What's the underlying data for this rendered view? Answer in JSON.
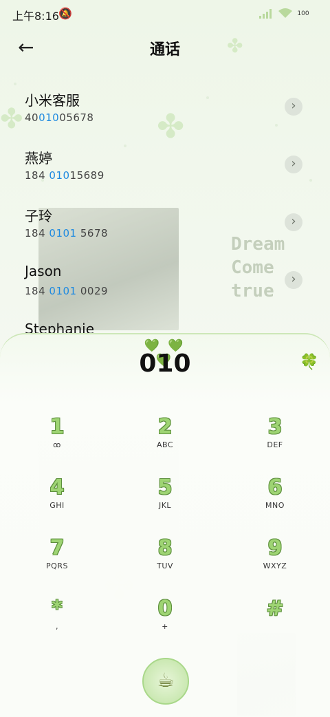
{
  "status_bar": {
    "time": "上午8:16",
    "mute_icon": "bell-off-icon",
    "battery": "100"
  },
  "header": {
    "back_icon": "arrow-left-icon",
    "title": "通话"
  },
  "results": [
    {
      "name": "小米客服",
      "number_pre": "40",
      "number_hl": "010",
      "number_post": "05678"
    },
    {
      "name": "燕婷",
      "number_pre": "184 ",
      "number_hl": "010",
      "number_post": "15689"
    },
    {
      "name": "子玲",
      "number_pre": "184 ",
      "number_hl": "0101",
      "number_post": " 5678"
    },
    {
      "name": "Jason",
      "number_pre": "184 ",
      "number_hl": "0101",
      "number_post": " 0029"
    },
    {
      "name": "Stephanie",
      "number_pre": "",
      "number_hl": "",
      "number_post": ""
    }
  ],
  "dialer": {
    "hearts": "💚💚💚",
    "input": "010",
    "clover_icon": "🍀",
    "keys": [
      {
        "digit": "1",
        "letters": "ꝏ"
      },
      {
        "digit": "2",
        "letters": "ABC"
      },
      {
        "digit": "3",
        "letters": "DEF"
      },
      {
        "digit": "4",
        "letters": "GHI"
      },
      {
        "digit": "5",
        "letters": "JKL"
      },
      {
        "digit": "6",
        "letters": "MNO"
      },
      {
        "digit": "7",
        "letters": "PQRS"
      },
      {
        "digit": "8",
        "letters": "TUV"
      },
      {
        "digit": "9",
        "letters": "WXYZ"
      },
      {
        "digit": "*",
        "letters": ","
      },
      {
        "digit": "0",
        "letters": "+"
      },
      {
        "digit": "#",
        "letters": ""
      }
    ],
    "call_icon": "☕"
  },
  "theme": {
    "highlight": "#1f8ae0",
    "accent": "#9ed473"
  }
}
